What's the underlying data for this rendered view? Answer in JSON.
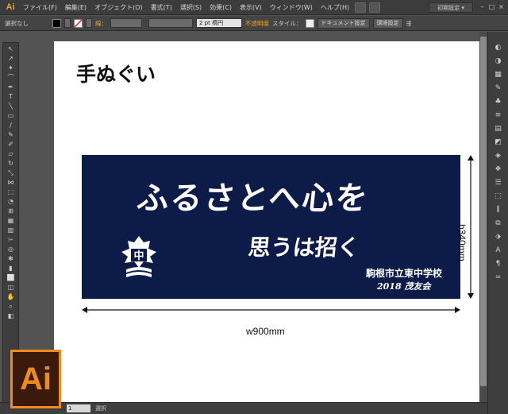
{
  "app": {
    "logo": "Ai",
    "menus": [
      "ファイル(F)",
      "編集(E)",
      "オブジェクト(O)",
      "書式(T)",
      "選択(S)",
      "効果(C)",
      "表示(V)",
      "ウィンドウ(W)",
      "ヘルプ(H)"
    ],
    "workspace": "初期設定 ▾",
    "window_controls": [
      "–",
      "□",
      "×"
    ]
  },
  "controlbar": {
    "selection": "選択なし",
    "stroke_label": "線：",
    "stroke_weight": "2 pt 楕円",
    "opacity_label": "不透明度",
    "style_label": "スタイル：",
    "document_setup": "ドキュメント設定",
    "preferences": "環境設定"
  },
  "artboard": {
    "title": "手ぬぐい",
    "towel": {
      "calligraphy_main": "ふるさとへ心を",
      "calligraphy_sub": "思うは招く",
      "school_name": "駒根市立東中学校",
      "school_year": "2018 茂友会",
      "emblem_char": "中"
    },
    "width_label": "w900mm",
    "height_label": "h340mm"
  },
  "statusbar": {
    "zoom": "1",
    "mode": "選択"
  },
  "badge": "Ai",
  "colors": {
    "towel": "#0d1b48",
    "accent": "#ef8a1e"
  }
}
